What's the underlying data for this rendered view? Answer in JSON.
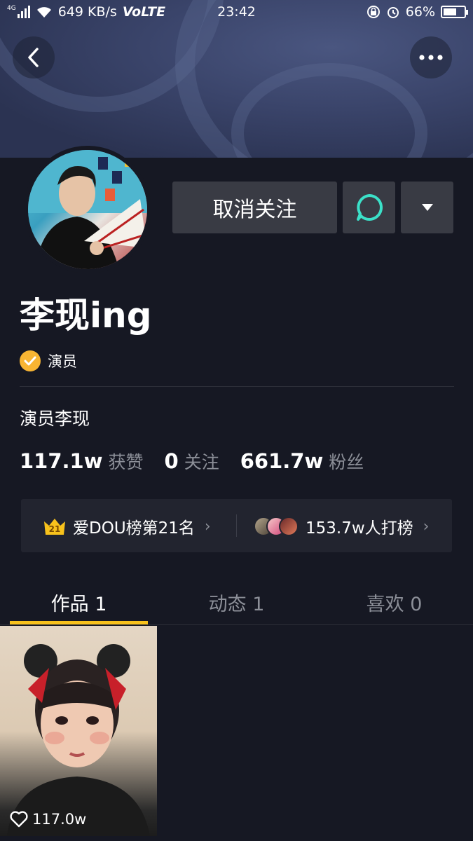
{
  "status_bar": {
    "network": "4G",
    "speed": "649 KB/s",
    "volte": "VoLTE",
    "time": "23:42",
    "battery": "66%",
    "battery_level": 0.66
  },
  "profile": {
    "name": "李现ing",
    "verify_label": "演员",
    "bio": "演员李现",
    "unfollow_label": "取消关注"
  },
  "stats": [
    {
      "value": "117.1w",
      "label": "获赞"
    },
    {
      "value": "0",
      "label": "关注"
    },
    {
      "value": "661.7w",
      "label": "粉丝"
    }
  ],
  "rank": {
    "badge_number": "21",
    "left_text": "爱DOU榜第21名",
    "right_text": "153.7w人打榜"
  },
  "tabs": [
    {
      "label": "作品 1"
    },
    {
      "label": "动态 1"
    },
    {
      "label": "喜欢 0"
    }
  ],
  "videos": [
    {
      "likes": "117.0w"
    }
  ],
  "colors": {
    "background": "#161823",
    "accent": "#f8c21c",
    "verify_badge": "#f8b533",
    "message_icon": "#3be0c8"
  }
}
